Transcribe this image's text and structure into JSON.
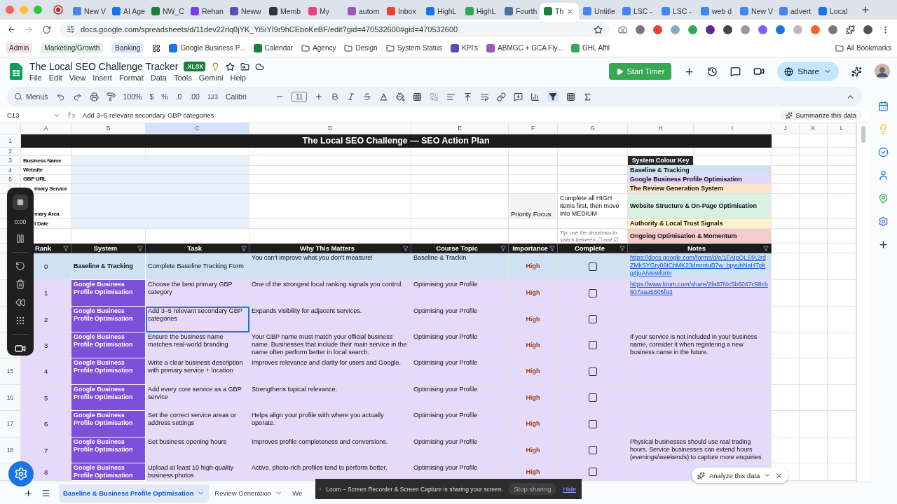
{
  "browser": {
    "tabs": [
      {
        "label": "New V",
        "selected": false
      },
      {
        "label": "AI Age",
        "selected": false
      },
      {
        "label": "NW_C",
        "selected": false
      },
      {
        "label": "Rehan",
        "selected": false
      },
      {
        "label": "Neww",
        "selected": false
      },
      {
        "label": "Memb",
        "selected": false
      },
      {
        "label": "My",
        "selected": false
      },
      {
        "label": "autom",
        "selected": false
      },
      {
        "label": "Inbox",
        "selected": false
      },
      {
        "label": "HighL",
        "selected": false
      },
      {
        "label": "HighL",
        "selected": false
      },
      {
        "label": "Fourth",
        "selected": false
      },
      {
        "label": "Th",
        "selected": true
      },
      {
        "label": "Untitle",
        "selected": false
      },
      {
        "label": "LSC -",
        "selected": false
      },
      {
        "label": "LSC -",
        "selected": false
      },
      {
        "label": "web d",
        "selected": false
      },
      {
        "label": "New V",
        "selected": false
      },
      {
        "label": "advert",
        "selected": false
      },
      {
        "label": "Local",
        "selected": false
      }
    ],
    "url": "docs.google.com/spreadsheets/d/11dev22rlq0jYK_Yi5iYI9r9hCEboKeBF/edit?gid=470532600#gid=470532600",
    "bookmarks": [
      {
        "label": "Admin",
        "kind": "tag",
        "color": "#f7e1f1"
      },
      {
        "label": "Marketing/Growth",
        "kind": "tag",
        "color": "#dff3e4"
      },
      {
        "label": "Banking",
        "kind": "tag",
        "color": "#dde9fb"
      },
      {
        "label": "Google Business P...",
        "kind": "site"
      },
      {
        "label": "Calendar",
        "kind": "site"
      },
      {
        "label": "Agency",
        "kind": "folder"
      },
      {
        "label": "Design",
        "kind": "folder"
      },
      {
        "label": "System Status",
        "kind": "folder"
      },
      {
        "label": "KPI's",
        "kind": "site"
      },
      {
        "label": "ABMGC + GCA Fly...",
        "kind": "site"
      },
      {
        "label": "GHL Affil",
        "kind": "site"
      }
    ],
    "all_bookmarks": "All Bookmarks"
  },
  "doc": {
    "title": "The Local SEO Challenge Tracker",
    "badge": ".XLSX",
    "menu": [
      "File",
      "Edit",
      "View",
      "Insert",
      "Format",
      "Data",
      "Tools",
      "Gemini",
      "Help"
    ],
    "start_timer": "Start Timer",
    "share": "Share"
  },
  "toolbar": {
    "search_placeholder": "Menus",
    "zoom": "100%",
    "currency": "$",
    "percent": "%",
    "decrease_decimal": ".0",
    "increase_decimal": ".00",
    "number_format": "123",
    "font": "Calibri",
    "font_size": "11",
    "filter_on": true
  },
  "formula_bar": {
    "cell": "C13",
    "formula": "Add 3–5 relevant secondary GBP categories",
    "summarize": "Summarize this data"
  },
  "sheet": {
    "column_letters": [
      {
        "label": "A",
        "selected": false
      },
      {
        "label": "B",
        "selected": false
      },
      {
        "label": "C",
        "selected": true
      },
      {
        "label": "D",
        "selected": false
      },
      {
        "label": "E",
        "selected": false
      },
      {
        "label": "F",
        "selected": false
      },
      {
        "label": "G",
        "selected": false
      },
      {
        "label": "H",
        "selected": false
      },
      {
        "label": "I",
        "selected": false
      },
      {
        "label": "J",
        "selected": false
      },
      {
        "label": "K",
        "selected": false
      },
      {
        "label": "L",
        "selected": false
      }
    ],
    "top_row_numbers": [
      "1",
      "2",
      "3",
      "4",
      "5"
    ],
    "title": "The Local SEO Challenge — SEO Action Plan",
    "info_labels": [
      "Business Name",
      "Website",
      "GBP URL",
      "imary Service",
      "mary Area",
      "t Date"
    ],
    "priority_label": "Priority Focus",
    "priority_text": "Complete all HIGH items first, then move into MEDIUM",
    "tip": "Tip: use the dropdown to switch between ☐ and ☑",
    "colour_key": {
      "title": "System Colour Key",
      "items": [
        {
          "label": "Baseline & Tracking",
          "color": "#cfe2f3"
        },
        {
          "label": "Google Business Profile Optimisation",
          "color": "#e4d7fb"
        },
        {
          "label": "The Review Generation System",
          "color": "#fce5cd"
        },
        {
          "label": "Website Structure & On-Page Optimisation",
          "color": "#d9f0e3"
        },
        {
          "label": "Authority & Local Trust Signals",
          "color": "#fff2cc"
        },
        {
          "label": "Ongoing Optimisation & Momentum",
          "color": "#f4cccc"
        }
      ]
    },
    "columns": [
      "Rank",
      "System",
      "Task",
      "Why This Matters",
      "Course Topic",
      "Importance",
      "Complete",
      "Notes"
    ],
    "rows": [
      {
        "kind": "baseline",
        "rank": "0",
        "system": "Baseline & Tracking",
        "task": "Complete Baseline Tracking Form",
        "why": "You can't improve what you don't measure!",
        "topic": "Baseline & Trackin",
        "importance": "High",
        "complete": false,
        "notes": {
          "kind": "link",
          "text": "https://docs.google.com/forms/d/e/1FAIpQLSfA2rdZMkSYGry06tChMK23dmrotuB7w_bpyubNaHTpkg4juA/viewform"
        }
      },
      {
        "kind": "gbp",
        "rank": "1",
        "system": "Google Business Profile Optimisation",
        "task": "Choose the best primary GBP category",
        "why": "One of the strongest local ranking signals you control.",
        "topic": "Optimising your Profile",
        "importance": "High",
        "complete": false,
        "notes": {
          "kind": "link",
          "text": "https://www.loom.com/share/2fa87f4c5b6047c98cb607aaa5505fa3"
        }
      },
      {
        "kind": "gbp",
        "rank": "2",
        "system": "Google Business Profile Optimisation",
        "task": "Add 3–5 relevant secondary GBP categories",
        "why": "Expands visibility for adjacent services.",
        "topic": "Optimising your Profile",
        "importance": "High",
        "complete": false,
        "selected": true
      },
      {
        "kind": "gbp",
        "rank": "3",
        "system": "Google Business Profile Optimisation",
        "task": "Ensure the business name matches real-world branding",
        "why": "Your GBP name must match your official business name. Businesses that include their main service in the name often perform better in local search.",
        "topic": "Optimising your Profile",
        "importance": "High",
        "complete": false,
        "notes": {
          "kind": "text",
          "text": "If your service is not included in your business name, consider it when registering a new business name in the future."
        }
      },
      {
        "kind": "gbp",
        "row_number": "15",
        "rank": "4",
        "system": "Google Business Profile Optimisation",
        "task": "Write a clear business description with primary service + location",
        "why": "Improves relevance and clarity for users and Google.",
        "topic": "Optimising your Profile",
        "importance": "High",
        "complete": false
      },
      {
        "kind": "gbp",
        "row_number": "16",
        "rank": "5",
        "system": "Google Business Profile Optimisation",
        "task": "Add every core service as a GBP service",
        "why": "Strengthens topical relevance.",
        "topic": "Optimising your Profile",
        "importance": "High",
        "complete": false
      },
      {
        "kind": "gbp",
        "row_number": "17",
        "rank": "6",
        "system": "Google Business Profile Optimisation",
        "task": "Set the correct service areas or address settings",
        "why": "Helps align your profile with where you actually operate.",
        "topic": "Optimising your Profile",
        "importance": "High",
        "complete": false
      },
      {
        "kind": "gbp",
        "row_number": "18",
        "rank": "7",
        "system": "Google Business Profile Optimisation",
        "task": "Set business opening hours",
        "why": "Improves profile completeness and conversions.",
        "topic": "Optimising your Profile",
        "importance": "High",
        "complete": false,
        "notes": {
          "kind": "text",
          "text": "Physical businesses should use real trading hours. Service businesses can extend hours (evenings/weekends) to capture more enquiries."
        }
      },
      {
        "kind": "gbp",
        "rank": "8",
        "system": "Google Business Profile Optimisation",
        "task": "Upload at least 10 high-quality business photos",
        "why": "Active, photo-rich profiles tend to perform better.",
        "topic": "Optimising your Profile",
        "importance": "High",
        "complete": false
      }
    ]
  },
  "sheet_tabs": [
    {
      "label": "Baseline & Business Profile Optimisation",
      "selected": true
    },
    {
      "label": "Review Generation",
      "selected": false
    },
    {
      "label": "We",
      "selected": false
    }
  ],
  "recorder": {
    "time": "0:00"
  },
  "analyze": "Analyze this data",
  "share_bar": {
    "message": "Loom – Screen Recorder & Screen Capture is sharing your screen.",
    "stop": "Stop sharing",
    "hide": "Hide"
  }
}
